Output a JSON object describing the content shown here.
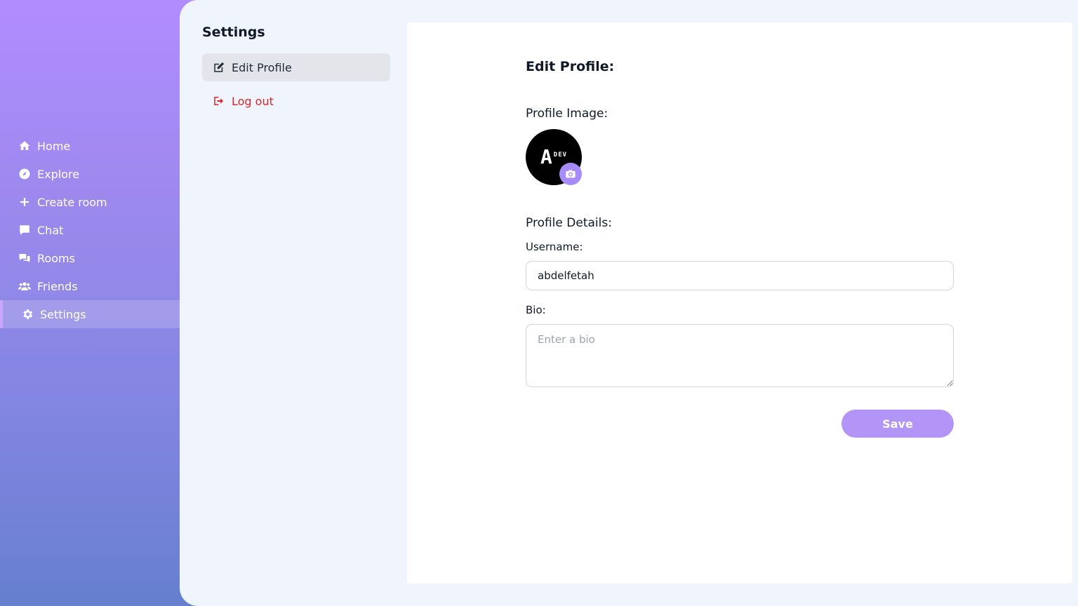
{
  "nav": {
    "items": [
      {
        "label": "Home",
        "icon": "home-icon"
      },
      {
        "label": "Explore",
        "icon": "compass-icon"
      },
      {
        "label": "Create room",
        "icon": "plus-icon"
      },
      {
        "label": "Chat",
        "icon": "chat-bubble-icon"
      },
      {
        "label": "Rooms",
        "icon": "comments-icon"
      },
      {
        "label": "Friends",
        "icon": "users-icon"
      },
      {
        "label": "Settings",
        "icon": "gear-icon",
        "active": true
      }
    ]
  },
  "settings": {
    "title": "Settings",
    "menu": [
      {
        "label": "Edit Profile",
        "icon": "edit-icon",
        "active": true
      },
      {
        "label": "Log out",
        "icon": "logout-icon",
        "color": "#dc2626"
      }
    ]
  },
  "form": {
    "heading": "Edit Profile:",
    "image_heading": "Profile Image:",
    "avatar_logo": {
      "big": "A",
      "small": "DEV"
    },
    "details_heading": "Profile Details:",
    "username_label": "Username:",
    "username_value": "abdelfetah",
    "bio_label": "Bio:",
    "bio_placeholder": "Enter a bio",
    "save_label": "Save"
  },
  "colors": {
    "accent": "#b394f7",
    "danger": "#dc2626",
    "panel_bg": "#eff4fd"
  }
}
